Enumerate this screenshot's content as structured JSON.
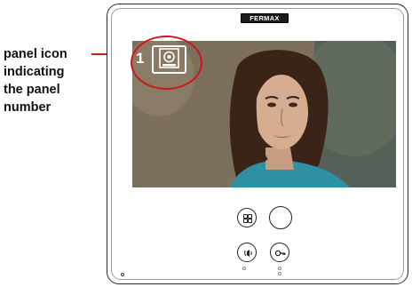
{
  "annotation": {
    "line1": "panel icon",
    "line2": "indicating",
    "line3": "the panel",
    "line4": "number"
  },
  "device": {
    "brand": "FERMAX"
  },
  "screen": {
    "panel_number": "1",
    "panel_icon": "door-panel-icon"
  },
  "controls": {
    "menu_icon": "menu-grid-icon",
    "home_icon": "circle-button-icon",
    "audio_icon": "audio-call-icon",
    "door_icon": "door-key-icon"
  },
  "colors": {
    "callout": "#d3141a"
  }
}
